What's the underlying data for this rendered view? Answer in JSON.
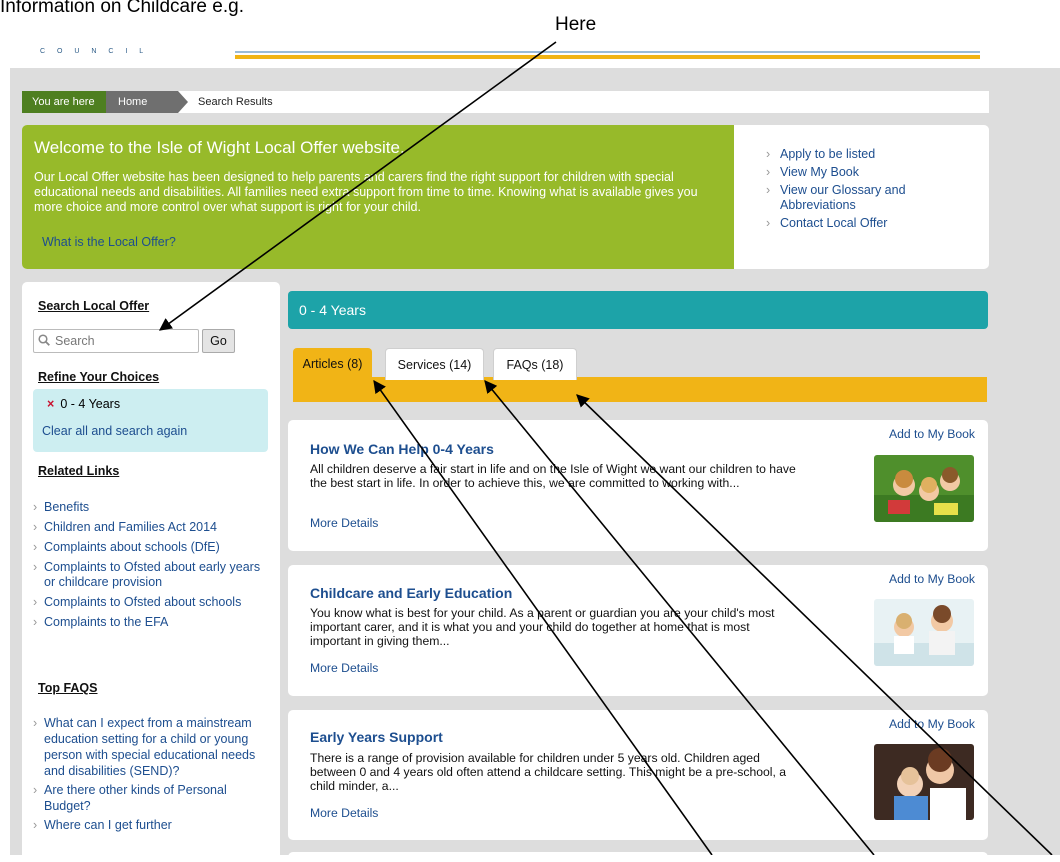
{
  "annotation": {
    "caption": "Information on Childcare e.g.",
    "pointer_label": "Here"
  },
  "header": {
    "council_text": "C O U N C I L"
  },
  "breadcrumb": {
    "here": "You are here",
    "home": "Home",
    "current": "Search Results"
  },
  "welcome": {
    "title": "Welcome to the Isle of Wight Local Offer website.",
    "body": "Our Local Offer website has been designed to help parents and carers find the right support for children with special educational needs and disabilities. All families need extra support from time to time. Knowing what is available gives you more choice and more control over what support is right for your child.",
    "link": "What is the Local Offer?"
  },
  "quick_links": [
    "Apply to be listed",
    "View My Book",
    "View our Glossary and Abbreviations",
    "Contact Local Offer"
  ],
  "sidebar": {
    "search_heading": "Search Local Offer",
    "search_placeholder": "Search",
    "go_label": "Go",
    "refine_heading": "Refine Your Choices",
    "refine_item": "0 - 4 Years",
    "clear_label": "Clear all and search again",
    "related_heading": "Related Links",
    "related_links": [
      "Benefits",
      "Children and Families Act 2014",
      "Complaints about schools (DfE)",
      "Complaints to Ofsted about early years or childcare provision",
      "Complaints to Ofsted about schools",
      "Complaints to the EFA"
    ],
    "faq_heading": "Top FAQS",
    "faqs": [
      "What can I expect from a mainstream education setting for a child or young person with special educational needs and disabilities (SEND)?",
      "Are there other kinds of Personal Budget?",
      "Where can I get further"
    ]
  },
  "results": {
    "age_band": "0 - 4 Years",
    "tabs": [
      {
        "label": "Articles (8)",
        "active": true
      },
      {
        "label": "Services (14)",
        "active": false
      },
      {
        "label": "FAQs (18)",
        "active": false
      }
    ],
    "cards": [
      {
        "title": "How We Can Help 0-4 Years",
        "body": "All children deserve a fair start in life and on the Isle of Wight we want our children to have the best start in life.  In order to achieve this, we are committed to working with...",
        "more": "More Details",
        "add": "Add to My Book"
      },
      {
        "title": "Childcare and Early Education",
        "body": "You know what is best for your child. As a parent or guardian you are your child's most important carer, and it is what you and your child do together at home that is most important in giving them...",
        "more": "More Details",
        "add": "Add to My Book"
      },
      {
        "title": "Early Years Support",
        "body": "There is a range of provision available for children under 5 years old. Children aged between 0 and 4 years old often attend a childcare setting. This might be a pre-school, a child minder, a...",
        "more": "More Details",
        "add": "Add to My Book"
      }
    ]
  },
  "colors": {
    "green": "#97ba2a",
    "teal": "#1da3a8",
    "yellow": "#f1b416",
    "link_blue": "#1d4e8f"
  }
}
